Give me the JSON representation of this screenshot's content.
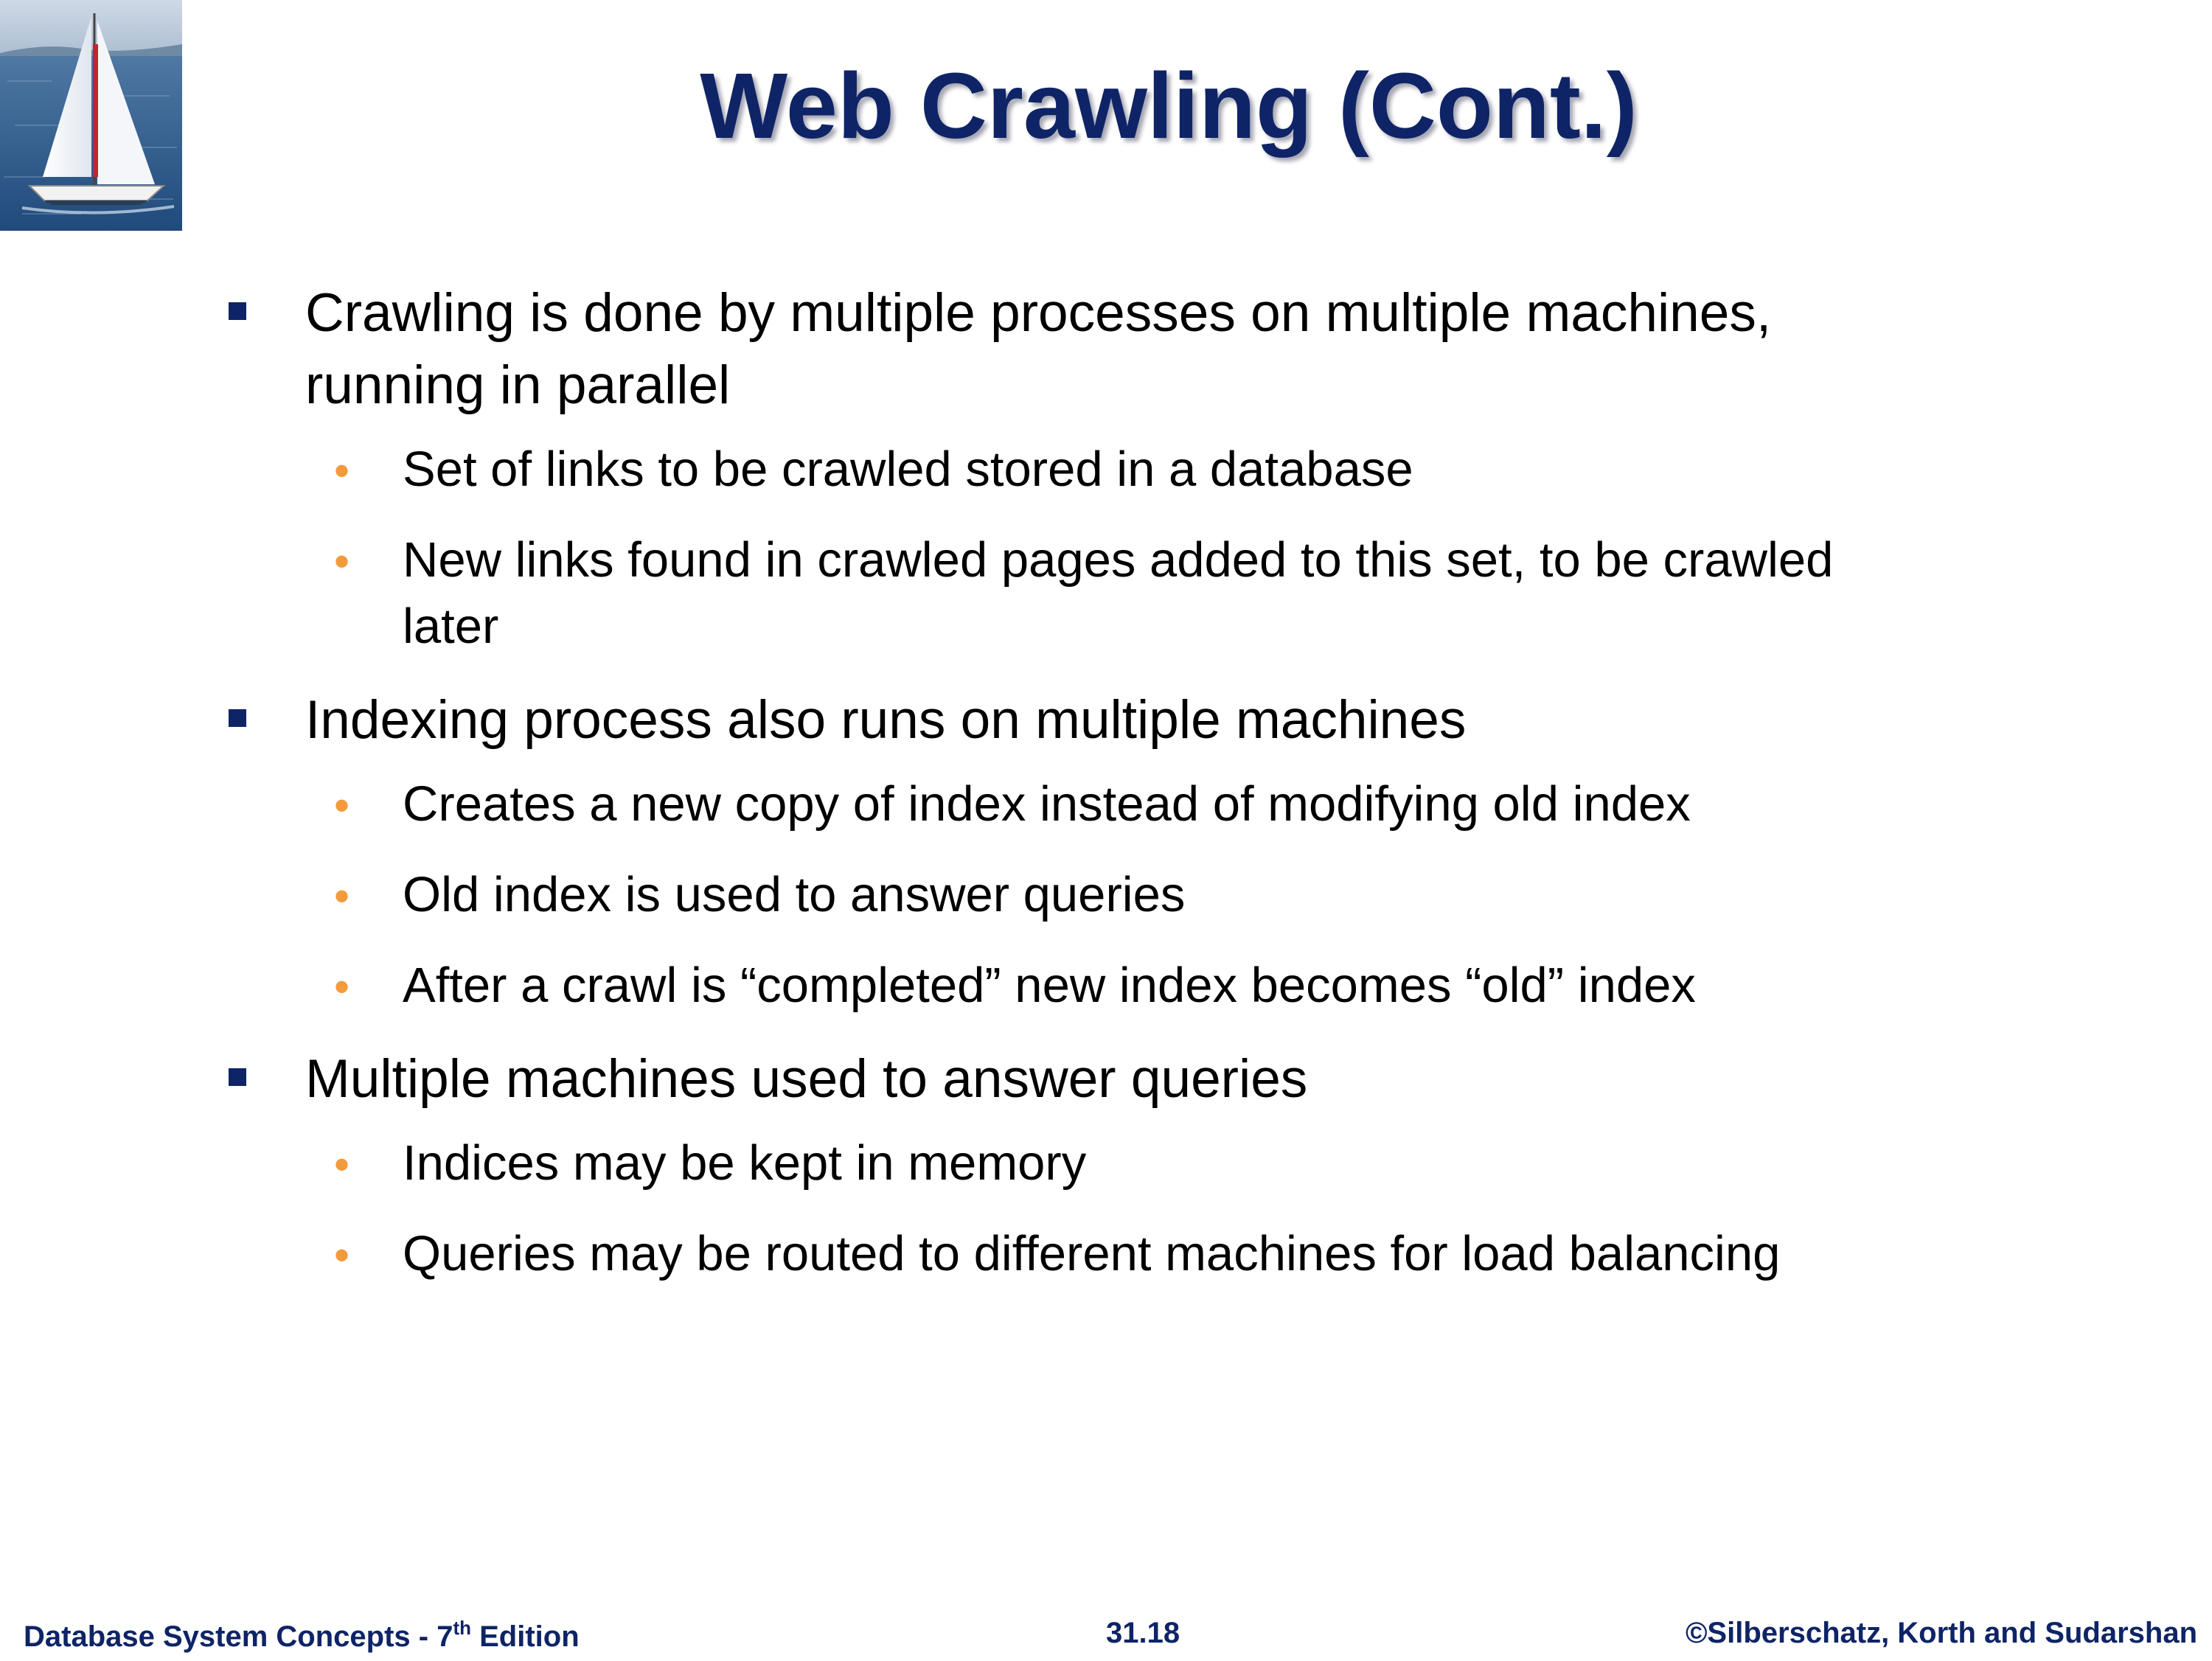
{
  "slide": {
    "title": "Web Crawling (Cont.)",
    "logo_icon": "sailboat-photo-icon"
  },
  "bullets": [
    {
      "text": "Crawling is done by multiple processes on multiple machines, running in parallel",
      "line1": "Crawling is done by multiple processes on multiple machines,",
      "line2": "running in parallel",
      "children": [
        {
          "text": "Set of links to be crawled stored in a database"
        },
        {
          "line1": "New links found in crawled pages added to this set, to be crawled",
          "line2": "later"
        }
      ]
    },
    {
      "text": "Indexing process also runs on multiple machines",
      "children": [
        {
          "text": "Creates a new copy of index instead of modifying old index"
        },
        {
          "text": "Old index is used to answer queries"
        },
        {
          "text": "After a crawl is “completed” new index becomes “old” index"
        }
      ]
    },
    {
      "text": "Multiple machines used to answer queries",
      "children": [
        {
          "text": "Indices may be kept in memory"
        },
        {
          "text": "Queries may be routed to different machines for load balancing"
        }
      ]
    }
  ],
  "footer": {
    "left_prefix": "Database System Concepts - 7",
    "left_sup": "th",
    "left_suffix": " Edition",
    "page_number": "31.18",
    "copyright": "©Silberschatz, Korth and Sudarshan"
  },
  "colors": {
    "title": "#0e2466",
    "level1_marker": "#0e2466",
    "level2_marker": "#f39a3c",
    "footer_text": "#0e2466"
  }
}
